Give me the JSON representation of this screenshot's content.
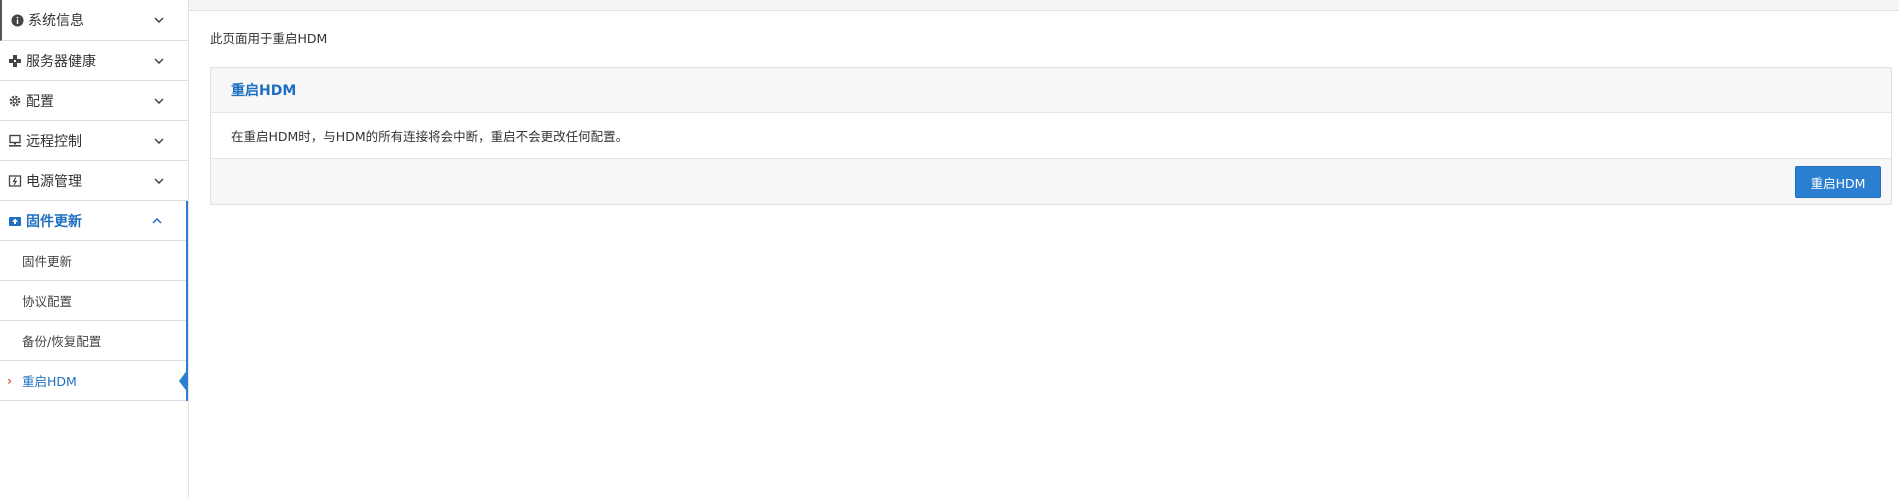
{
  "sidebar": {
    "items": [
      {
        "label": "系统信息",
        "icon": "info-icon"
      },
      {
        "label": "服务器健康",
        "icon": "health-icon"
      },
      {
        "label": "配置",
        "icon": "gear-icon"
      },
      {
        "label": "远程控制",
        "icon": "remote-control-icon"
      },
      {
        "label": "电源管理",
        "icon": "power-icon"
      },
      {
        "label": "固件更新",
        "icon": "firmware-update-icon"
      }
    ],
    "subitems": [
      {
        "label": "固件更新"
      },
      {
        "label": "协议配置"
      },
      {
        "label": "备份/恢复配置"
      },
      {
        "label": "重启HDM"
      }
    ]
  },
  "main": {
    "intro": "此页面用于重启HDM",
    "panel": {
      "title": "重启HDM",
      "body": "在重启HDM时，与HDM的所有连接将会中断，重启不会更改任何配置。",
      "button": "重启HDM"
    }
  },
  "colors": {
    "accent": "#2a7fd0",
    "active_text": "#1f6fc0",
    "current_marker": "#e0572c"
  }
}
